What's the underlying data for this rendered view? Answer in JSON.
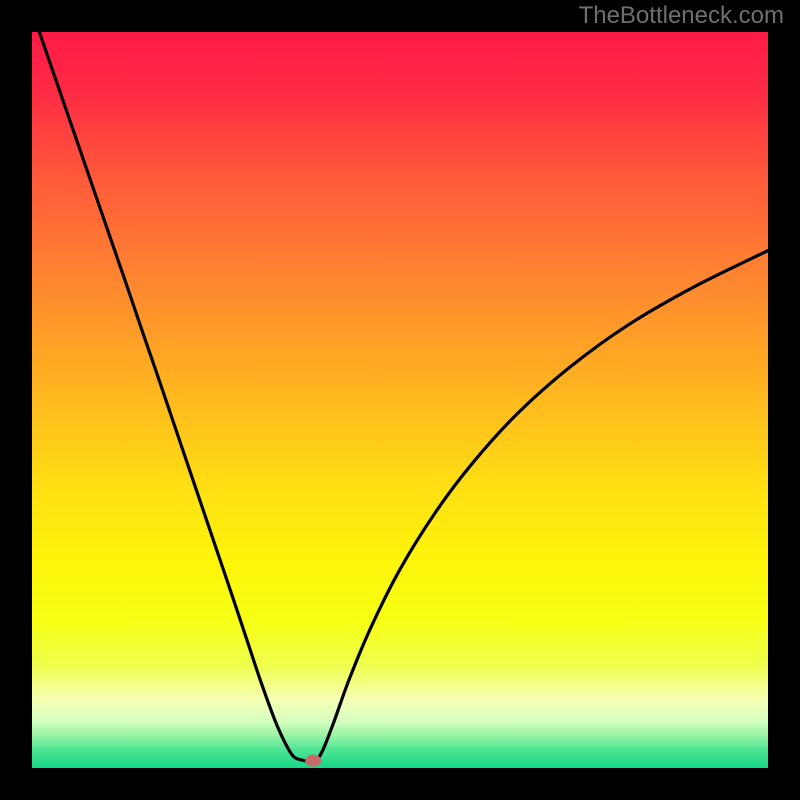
{
  "watermark": "TheBottleneck.com",
  "chart_data": {
    "type": "line",
    "title": "",
    "xlabel": "",
    "ylabel": "",
    "xlim": [
      0,
      100
    ],
    "ylim": [
      0,
      100
    ],
    "minimum_x": 37,
    "marker": {
      "x": 38.2,
      "y": 1.0,
      "color": "#c76a6a"
    },
    "gradient_stops": [
      {
        "pct": 0.0,
        "color": "#ff1a46"
      },
      {
        "pct": 0.08,
        "color": "#ff2a44"
      },
      {
        "pct": 0.2,
        "color": "#ff5a3a"
      },
      {
        "pct": 0.35,
        "color": "#ff8a2f"
      },
      {
        "pct": 0.5,
        "color": "#ffb91e"
      },
      {
        "pct": 0.62,
        "color": "#ffe013"
      },
      {
        "pct": 0.72,
        "color": "#fdf50a"
      },
      {
        "pct": 0.8,
        "color": "#f6ff14"
      },
      {
        "pct": 0.86,
        "color": "#efff4d"
      },
      {
        "pct": 0.905,
        "color": "#f6ffb0"
      },
      {
        "pct": 0.935,
        "color": "#d8ffc1"
      },
      {
        "pct": 0.955,
        "color": "#9cf5a6"
      },
      {
        "pct": 0.975,
        "color": "#4ee593"
      },
      {
        "pct": 1.0,
        "color": "#14d886"
      }
    ],
    "series": [
      {
        "name": "bottleneck-curve",
        "x": [
          1,
          3,
          5,
          7,
          9,
          11,
          13,
          15,
          17,
          19,
          21,
          23,
          25,
          27,
          29,
          31,
          33,
          34.5,
          35.6,
          37,
          38.5,
          39.5,
          41,
          43,
          46,
          50,
          55,
          60,
          66,
          73,
          81,
          90,
          100
        ],
        "y": [
          100,
          94.2,
          88.4,
          82.6,
          76.8,
          71.0,
          65.2,
          59.3,
          53.5,
          47.6,
          41.7,
          35.8,
          29.9,
          24.0,
          18.0,
          12.0,
          6.5,
          3.2,
          1.5,
          1.0,
          1.0,
          2.4,
          6.2,
          11.8,
          19.0,
          27.0,
          35.0,
          41.6,
          48.2,
          54.4,
          60.2,
          65.4,
          70.3
        ]
      }
    ]
  }
}
